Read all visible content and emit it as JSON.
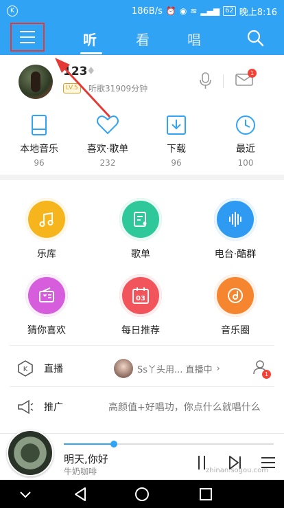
{
  "status_bar": {
    "net_speed": "186B/s",
    "battery": "62",
    "time": "晚上8:16"
  },
  "header": {
    "tabs": [
      {
        "label": "听",
        "active": true
      },
      {
        "label": "看",
        "active": false
      },
      {
        "label": "唱",
        "active": false
      }
    ],
    "menu_icon": "hamburger-menu-icon",
    "search_icon": "search-icon",
    "accent_color": "#31a3f5"
  },
  "profile": {
    "username": "123",
    "level": "LV.5",
    "listen_time": "听歌31909分钟",
    "message_badge": "1"
  },
  "quick_access": [
    {
      "label": "本地音乐",
      "count": "96",
      "icon": "phone-icon"
    },
    {
      "label": "喜欢·歌单",
      "count": "232",
      "icon": "heart-icon"
    },
    {
      "label": "下载",
      "count": "96",
      "icon": "download-icon"
    },
    {
      "label": "最近",
      "count": "100",
      "icon": "clock-icon"
    }
  ],
  "grid": [
    {
      "label": "乐库",
      "icon": "music-note-icon",
      "color": "#f7b51d"
    },
    {
      "label": "歌单",
      "icon": "songlist-icon",
      "color": "#2fc89a"
    },
    {
      "label": "电台·酷群",
      "icon": "soundwave-icon",
      "color": "#2f9af2"
    },
    {
      "label": "猜你喜欢",
      "icon": "radio-icon",
      "color": "#d65ddb"
    },
    {
      "label": "每日推荐",
      "icon": "calendar-icon",
      "color": "#f2545b"
    },
    {
      "label": "音乐圈",
      "icon": "music-circle-icon",
      "color": "#f5862f"
    }
  ],
  "calendar_day": "03",
  "live_row": {
    "title": "直播",
    "info": "Ss丫头用... 直播中",
    "badge": "1"
  },
  "promo_row": {
    "title": "推广",
    "text": "高颜值+好唱功，你点什么就唱什么"
  },
  "player": {
    "song_title": "明天,你好",
    "artist": "牛奶咖啡",
    "progress": 0.24,
    "watermark": "zhinan.sogou.com"
  }
}
